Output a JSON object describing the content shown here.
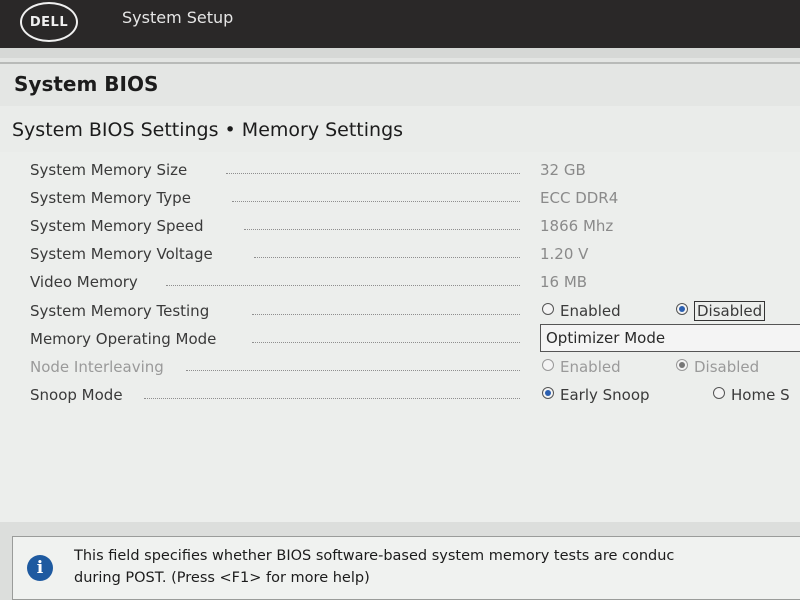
{
  "topbar": {
    "logo_text": "DELL",
    "app_title": "System Setup"
  },
  "page": {
    "title": "System BIOS",
    "subtitle": "System BIOS Settings • Memory Settings"
  },
  "settings": [
    {
      "label": "System Memory Size",
      "value": "32 GB"
    },
    {
      "label": "System Memory Type",
      "value": "ECC DDR4"
    },
    {
      "label": "System Memory Speed",
      "value": "1866 Mhz"
    },
    {
      "label": "System Memory Voltage",
      "value": "1.20 V"
    },
    {
      "label": "Video Memory",
      "value": "16 MB"
    },
    {
      "label": "System Memory Testing",
      "options": [
        "Enabled",
        "Disabled"
      ],
      "selected": "Disabled"
    },
    {
      "label": "Memory Operating Mode",
      "value": "Optimizer Mode"
    },
    {
      "label": "Node Interleaving",
      "options": [
        "Enabled",
        "Disabled"
      ],
      "selected": "Disabled",
      "disabled": true
    },
    {
      "label": "Snoop Mode",
      "options": [
        "Early Snoop",
        "Home S"
      ],
      "selected": "Early Snoop"
    }
  ],
  "help": {
    "icon": "info-icon",
    "line1": "This field specifies whether BIOS software-based system memory tests are conduc",
    "line2": "during POST. (Press <F1> for more help)"
  }
}
